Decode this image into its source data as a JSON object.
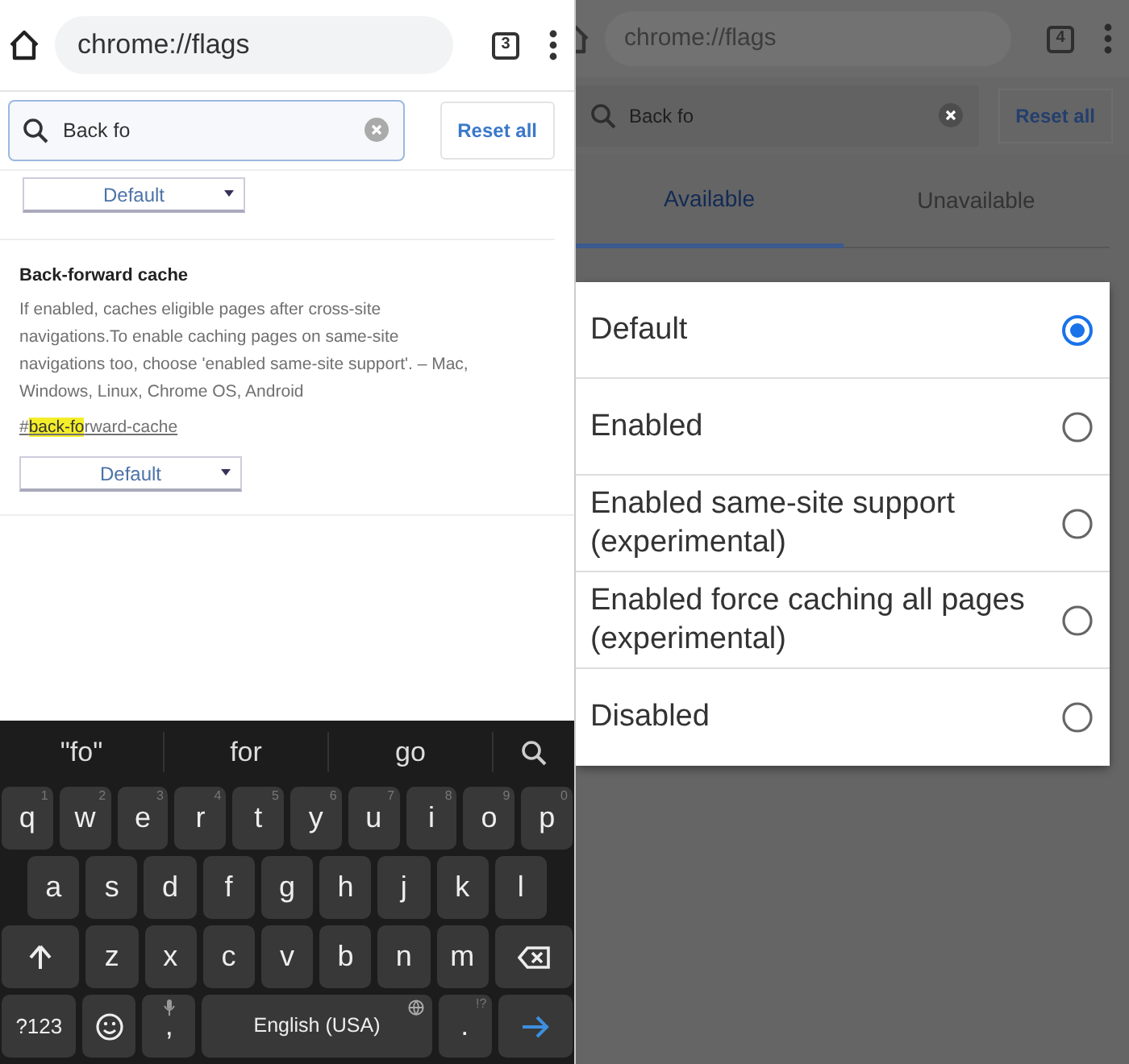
{
  "left": {
    "toolbar": {
      "url": "chrome://flags",
      "tab_count": "3"
    },
    "search": {
      "value": "Back fo"
    },
    "reset_button": "Reset all",
    "flags": [
      {
        "select": "Default"
      },
      {
        "title": "Back-forward cache",
        "description": "If enabled, caches eligible pages after cross-site navigations.To enable caching pages on same-site navigations too, choose 'enabled same-site support'. – Mac, Windows, Linux, Chrome OS, Android",
        "link_parts": [
          {
            "text": "#",
            "highlighted": false
          },
          {
            "text": "back-fo",
            "highlighted": true
          },
          {
            "text": "rward-cache",
            "highlighted": false
          }
        ],
        "select": "Default"
      }
    ],
    "keyboard": {
      "suggestions": [
        "\"fo\"",
        "for",
        "go"
      ],
      "key_rows": [
        {
          "keys": [
            {
              "kind": "letter",
              "label": "q",
              "hint": "1"
            },
            {
              "kind": "letter",
              "label": "w",
              "hint": "2"
            },
            {
              "kind": "letter",
              "label": "e",
              "hint": "3"
            },
            {
              "kind": "letter",
              "label": "r",
              "hint": "4"
            },
            {
              "kind": "letter",
              "label": "t",
              "hint": "5"
            },
            {
              "kind": "letter",
              "label": "y",
              "hint": "6"
            },
            {
              "kind": "letter",
              "label": "u",
              "hint": "7"
            },
            {
              "kind": "letter",
              "label": "i",
              "hint": "8"
            },
            {
              "kind": "letter",
              "label": "o",
              "hint": "9"
            },
            {
              "kind": "letter",
              "label": "p",
              "hint": "0"
            }
          ]
        },
        {
          "keys": [
            {
              "kind": "letter",
              "label": "a"
            },
            {
              "kind": "letter",
              "label": "s"
            },
            {
              "kind": "letter",
              "label": "d"
            },
            {
              "kind": "letter",
              "label": "f"
            },
            {
              "kind": "letter",
              "label": "g"
            },
            {
              "kind": "letter",
              "label": "h"
            },
            {
              "kind": "letter",
              "label": "j"
            },
            {
              "kind": "letter",
              "label": "k"
            },
            {
              "kind": "letter",
              "label": "l"
            }
          ]
        },
        {
          "keys": [
            {
              "kind": "shift"
            },
            {
              "kind": "letter",
              "label": "z"
            },
            {
              "kind": "letter",
              "label": "x"
            },
            {
              "kind": "letter",
              "label": "c"
            },
            {
              "kind": "letter",
              "label": "v"
            },
            {
              "kind": "letter",
              "label": "b"
            },
            {
              "kind": "letter",
              "label": "n"
            },
            {
              "kind": "letter",
              "label": "m"
            },
            {
              "kind": "backspace"
            }
          ]
        },
        {
          "keys": [
            {
              "kind": "symbols",
              "label": "?123"
            },
            {
              "kind": "emoji"
            },
            {
              "kind": "comma",
              "label": ","
            },
            {
              "kind": "space",
              "label": "English (USA)"
            },
            {
              "kind": "period",
              "label": ".",
              "hint": "!?"
            },
            {
              "kind": "enter"
            }
          ]
        }
      ]
    }
  },
  "right": {
    "toolbar": {
      "url": "chrome://flags",
      "tab_count": "4"
    },
    "search": {
      "value": "Back fo"
    },
    "reset_button": "Reset all",
    "tabs": [
      {
        "label": "Available",
        "selected": true
      },
      {
        "label": "Unavailable",
        "selected": false
      }
    ],
    "dialog": {
      "options": [
        {
          "label": "Default",
          "selected": true
        },
        {
          "label": "Enabled",
          "selected": false
        },
        {
          "label": "Enabled same-site support (experimental)",
          "selected": false
        },
        {
          "label": "Enabled force caching all pages (experimental)",
          "selected": false
        },
        {
          "label": "Disabled",
          "selected": false
        }
      ]
    }
  }
}
